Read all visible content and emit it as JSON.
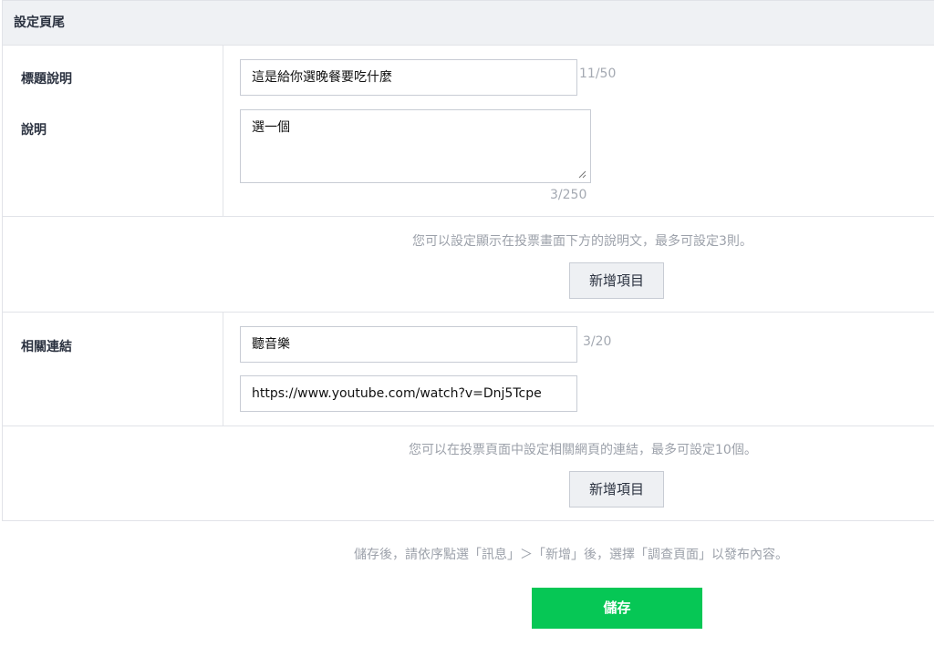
{
  "header": {
    "title": "設定頁尾"
  },
  "description_section": {
    "title_label": "標題說明",
    "title_value": "這是給你選晚餐要吃什麼",
    "title_counter": "11/50",
    "desc_label": "說明",
    "desc_value": "選一個",
    "desc_counter": "3/250",
    "hint": "您可以設定顯示在投票畫面下方的說明文，最多可設定3則。",
    "add_button": "新增項目"
  },
  "links_section": {
    "label": "相關連結",
    "link_title_value": "聽音樂",
    "link_title_counter": "3/20",
    "link_url_value": "https://www.youtube.com/watch?v=Dnj5Tcpe",
    "hint": "您可以在投票頁面中設定相關網頁的連結，最多可設定10個。",
    "add_button": "新增項目"
  },
  "footer": {
    "note": "儲存後，請依序點選「訊息」＞「新增」後，選擇「調查頁面」以發布內容。",
    "save_button": "儲存"
  },
  "colors": {
    "accent": "#06c755",
    "header_bg": "#eff1f4",
    "border": "#e1e3e8"
  }
}
